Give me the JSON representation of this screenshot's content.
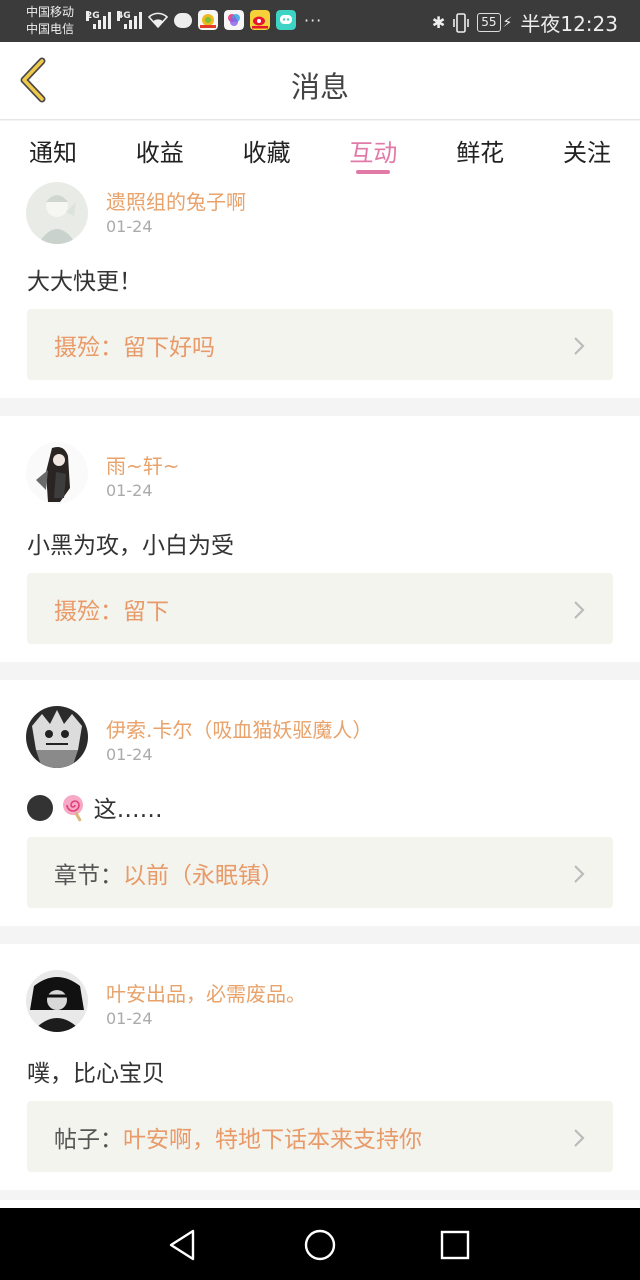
{
  "status_bar": {
    "carrier1": "中国移动",
    "carrier2": "中国电信",
    "net1": "2G",
    "net2": "4G",
    "more": "···",
    "battery": "55",
    "time": "半夜12:23"
  },
  "nav": {
    "title": "消息"
  },
  "tabs": [
    {
      "label": "通知",
      "active": false
    },
    {
      "label": "收益",
      "active": false
    },
    {
      "label": "收藏",
      "active": false
    },
    {
      "label": "互动",
      "active": true
    },
    {
      "label": "鲜花",
      "active": false
    },
    {
      "label": "关注",
      "active": false
    }
  ],
  "feed": [
    {
      "user": "遗照组的兔子啊",
      "date": "01-24",
      "content": "大大快更！",
      "ref_label": "摄殓：",
      "ref_title": "留下好吗"
    },
    {
      "user": "雨~轩~",
      "date": "01-24",
      "content": "小黑为攻，小白为受",
      "ref_label": "摄殓：",
      "ref_title": "留下"
    },
    {
      "user": "伊索.卡尔（吸血猫妖驱魔人）",
      "date": "01-24",
      "content": "这……",
      "ref_label": "章节：",
      "ref_title": "以前（永眠镇）"
    },
    {
      "user": "叶安出品，必需废品。",
      "date": "01-24",
      "content": "噗，比心宝贝",
      "ref_label": "帖子：",
      "ref_title": "叶安啊，特地下话本来支持你"
    }
  ],
  "colors": {
    "accent_pink": "#e27aa8",
    "accent_orange": "#e89a68",
    "ref_bg": "#f4f4ef"
  }
}
